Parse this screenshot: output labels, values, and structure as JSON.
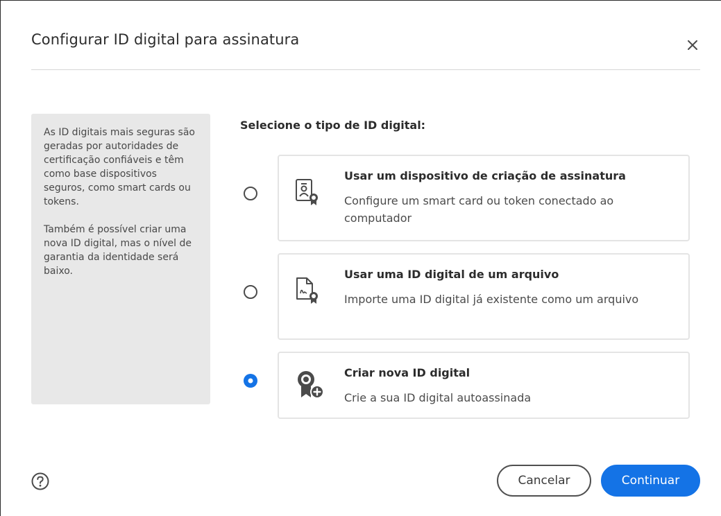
{
  "dialog": {
    "title": "Configurar ID digital para assinatura"
  },
  "info_panel": {
    "paragraphs": [
      "As ID digitais mais seguras são geradas por autoridades de certificação confiáveis e têm como base dispositivos seguros, como smart cards ou tokens.",
      "Também é possível criar uma nova ID digital, mas o nível de garantia da identidade será baixo."
    ]
  },
  "selection": {
    "label": "Selecione o tipo de ID digital:",
    "options": [
      {
        "title": "Usar um dispositivo de criação de assinatura",
        "description": "Configure um smart card ou token conectado ao computador",
        "icon": "signature-device-icon",
        "selected": false
      },
      {
        "title": "Usar uma ID digital de um arquivo",
        "description": "Importe uma ID digital já existente como um arquivo",
        "icon": "digital-id-file-icon",
        "selected": false
      },
      {
        "title": "Criar nova ID digital",
        "description": "Crie a sua ID digital autoassinada",
        "icon": "new-digital-id-icon",
        "selected": true
      }
    ]
  },
  "footer": {
    "cancel_label": "Cancelar",
    "continue_label": "Continuar"
  },
  "colors": {
    "accent": "#1473e6",
    "panel_bg": "#e8e8e8",
    "card_border": "#e4e4e4"
  }
}
